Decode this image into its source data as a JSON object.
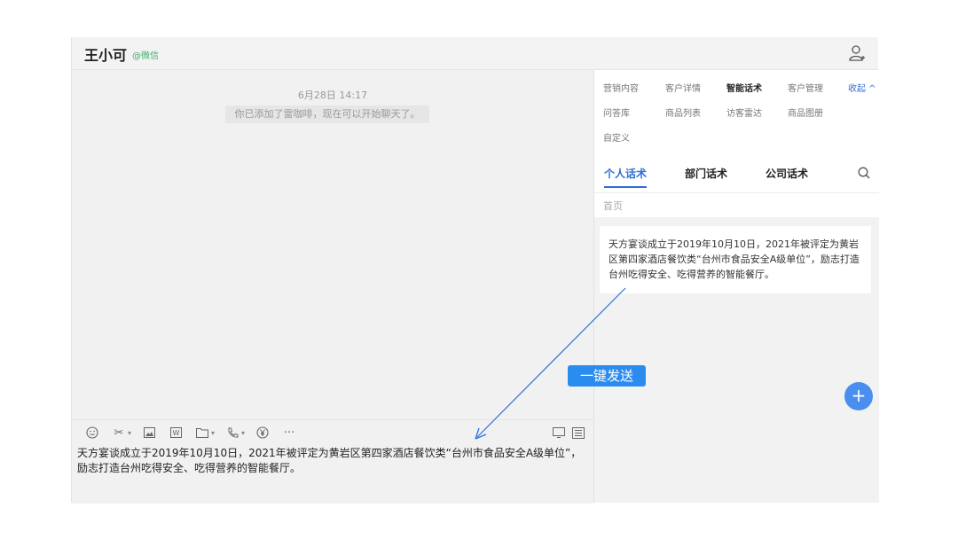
{
  "header": {
    "contact_name": "王小可",
    "wechat_tag": "@微信"
  },
  "chat": {
    "timestamp": "6月28日 14:17",
    "system_message": "你已添加了雷咖啡，现在可以开始聊天了。"
  },
  "compose": {
    "text": "天方宴谈成立于2019年10月10日，2021年被评定为黄岩区第四家酒店餐饮类“台州市食品安全A级单位”，励志打造台州吃得安全、吃得营养的智能餐厅。"
  },
  "sidebar": {
    "row1": [
      "营销内容",
      "客户详情",
      "智能话术",
      "客户管理",
      "收起 ^"
    ],
    "row2": [
      "问答库",
      "商品列表",
      "访客雷达",
      "商品图册"
    ],
    "row3": [
      "自定义"
    ],
    "script_tabs": [
      "个人话术",
      "部门话术",
      "公司话术"
    ],
    "breadcrumb": "首页",
    "card_text": "天方宴谈成立于2019年10月10日，2021年被评定为黄岩区第四家酒店餐饮类“台州市食品安全A级单位”，励志打造台州吃得安全、吃得营养的智能餐厅。"
  },
  "annotation": {
    "send_label": "一键发送"
  },
  "fab_label": "+",
  "colors": {
    "accent": "#2d6fd6",
    "send_button": "#2b8cf0",
    "wechat_green": "#3fae6b"
  },
  "icons": [
    "person-add-icon",
    "emoji-icon",
    "scissors-icon",
    "image-icon",
    "word-icon",
    "folder-icon",
    "phone-icon",
    "yuan-icon",
    "more-icon",
    "screen-icon",
    "list-icon",
    "search-icon",
    "plus-icon"
  ]
}
